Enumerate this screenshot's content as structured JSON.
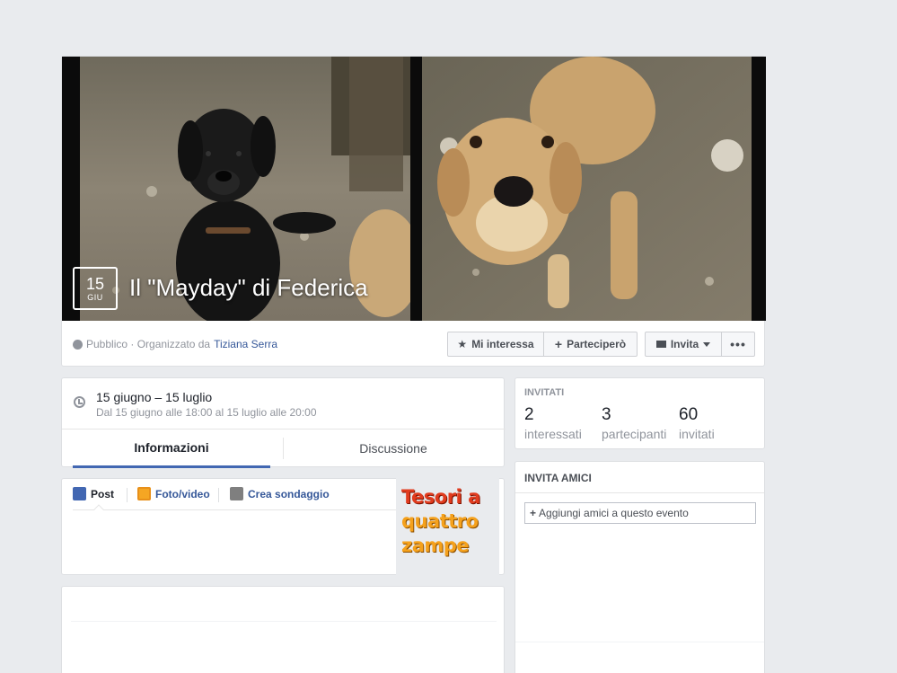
{
  "event": {
    "day": "15",
    "month": "GIU",
    "title": "Il \"Mayday\" di Federica",
    "privacy": "Pubblico · Organizzato da",
    "organizer": "Tiziana Serra",
    "when_main": "15 giugno – 15 luglio",
    "when_sub": "Dal 15 giugno alle 18:00 al 15 luglio alle 20:00"
  },
  "actions": {
    "interest": "Mi interessa",
    "going": "Parteciperò",
    "invite": "Invita",
    "more": "•••"
  },
  "tabs": [
    {
      "label": "Informazioni"
    },
    {
      "label": "Discussione"
    }
  ],
  "composer": {
    "post": "Post",
    "photo": "Foto/video",
    "poll": "Crea sondaggio"
  },
  "ad": {
    "line1": "Tesori a",
    "line2": "quattro",
    "line3": "zampe"
  },
  "invited": {
    "heading": "INVITATI",
    "stats": [
      {
        "num": "2",
        "label": "interessati"
      },
      {
        "num": "3",
        "label": "partecipanti"
      },
      {
        "num": "60",
        "label": "invitati"
      }
    ]
  },
  "invite_friends": {
    "heading": "INVITA AMICI",
    "placeholder": "Aggiungi amici a questo evento"
  },
  "colors": {
    "page_bg": "#e9ebee",
    "link": "#365899",
    "accent": "#4267b2"
  }
}
